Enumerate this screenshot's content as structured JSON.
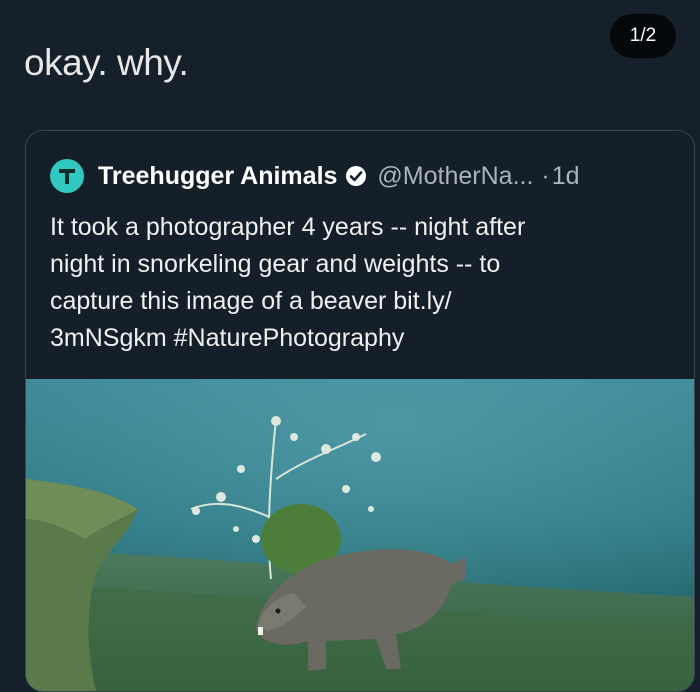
{
  "page_counter": "1/2",
  "post": {
    "text": "okay. why."
  },
  "quote": {
    "author_name": "Treehugger Animals",
    "handle": "@MotherNa...",
    "separator": "·",
    "time": "1d",
    "text_lines": [
      "It took a photographer 4 years -- night after",
      "night in snorkeling gear and weights -- to",
      "capture this image of a beaver bit.ly/",
      "3mNSgkm #NaturePhotography"
    ],
    "icons": {
      "avatar": "treehugger-logo-icon",
      "verified": "verified-badge-icon"
    },
    "colors": {
      "avatar_bg": "#30c8c0",
      "background": "#16202b"
    }
  }
}
